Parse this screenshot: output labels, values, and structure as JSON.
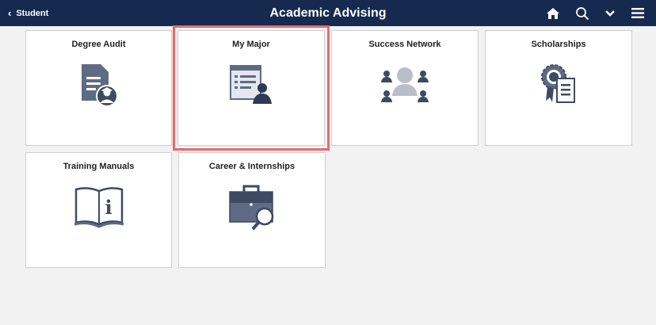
{
  "header": {
    "back_label": "Student",
    "title": "Academic Advising",
    "icons": [
      "home-icon",
      "search-icon",
      "chevron-down-icon",
      "menu-icon"
    ]
  },
  "colors": {
    "header_bg": "#152a4e",
    "icon_dark": "#3d4a63",
    "icon_mid": "#8a92a3",
    "highlight": "#e8696b"
  },
  "tiles": [
    {
      "title": "Degree Audit",
      "icon": "degree-audit-icon"
    },
    {
      "title": "My Major",
      "icon": "my-major-icon",
      "selected": true
    },
    {
      "title": "Success Network",
      "icon": "success-network-icon"
    },
    {
      "title": "Scholarships",
      "icon": "scholarships-icon"
    },
    {
      "title": "Training Manuals",
      "icon": "training-manuals-icon"
    },
    {
      "title": "Career & Internships",
      "icon": "career-internships-icon"
    }
  ]
}
